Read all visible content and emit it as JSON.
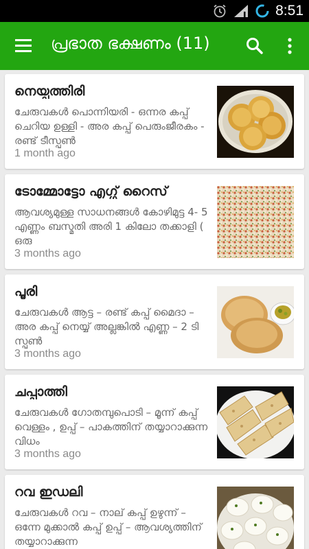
{
  "status_bar": {
    "time": "8:51",
    "icons": [
      "alarm-icon",
      "signal-icon",
      "sync-icon"
    ]
  },
  "app_bar": {
    "title": "പ്രഭാത ഭക്ഷണം (11)",
    "menu_icon": "hamburger-menu-icon",
    "search_icon": "search-icon",
    "more_icon": "more-vert-icon",
    "color": "#23a611"
  },
  "recipes": [
    {
      "title": "നെയ്പത്തിരി",
      "snippet": "ചേരുവകൾ  പൊന്നിയരി - ഒന്നര കപ്പ് ചെറിയ ഉള്ളി - അര കപ്പ് പെരുംജീരകം - രണ്ട് ടീസ്പൂൺ",
      "time": "1 month ago"
    },
    {
      "title": "ടോമ്മോട്ടോ എഗ്ഗ് റൈസ്",
      "snippet": "ആവശ്യമുള്ള സാധനങ്ങൾ കോഴിമുട്ട 4- 5 എണ്ണം ബസ്മതി അരി 1 കിലോ തക്കാളി  ( ഒരു",
      "time": "3 months ago"
    },
    {
      "title": "പൂരി",
      "snippet": "ചേരുവകൾ ആട്ട – രണ്ട് കപ്പ് മൈദാ – അര കപ്പ് നെയ്യ് അല്ലങ്കിൽ എണ്ണ – 2 ടി സ്പൂൺ",
      "time": "3 months ago"
    },
    {
      "title": "ചപ്പാത്തി",
      "snippet": "ചേരുവകൾ ഗോതമ്പുപൊടി – മൂന്ന് കപ്പ് വെള്ളം , ഉപ്പ് – പാകത്തിന് തയ്യാറാക്കുന്ന വിധം",
      "time": "3 months ago"
    },
    {
      "title": "റവ ഇഡലി",
      "snippet": "ചേരുവകൾ റവ – നാല് കപ്പ് ഉഴുന്ന് – ഒന്നേ മുക്കാൽ കപ്പ് ഉപ്പ് – ആവശ്യത്തിന് തയ്യാറാക്കുന്ന",
      "time": ""
    }
  ]
}
